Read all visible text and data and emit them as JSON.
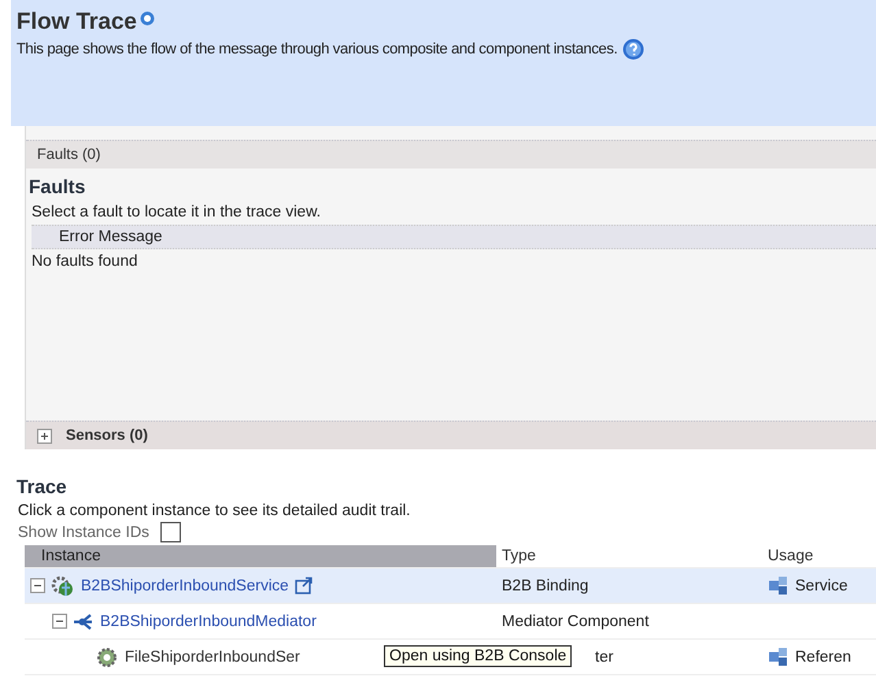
{
  "header": {
    "title": "Flow Trace",
    "description": "This page shows the flow of the message through various composite and component instances."
  },
  "faults_panel": {
    "bar_label": "Faults (0)",
    "heading": "Faults",
    "hint": "Select a fault to locate it in the trace view.",
    "column": "Error Message",
    "empty_text": "No faults found"
  },
  "sensors_panel": {
    "bar_label": "Sensors (0)",
    "expanded": false
  },
  "trace": {
    "heading": "Trace",
    "hint": "Click a component instance to see its detailed audit trail.",
    "show_ids": {
      "label": "Show Instance IDs",
      "checked": false
    },
    "columns": [
      "Instance",
      "Type",
      "Usage"
    ],
    "rows": [
      {
        "name": "B2BShiporderInboundService",
        "type": "B2B Binding",
        "usage": "Service",
        "kind": "service",
        "expanded": true,
        "selected": true,
        "children": [
          {
            "name": "B2BShiporderInboundMediator",
            "type": "Mediator Component",
            "kind": "mediator",
            "expanded": true,
            "selected": false,
            "children": [
              {
                "name": "FileShiporderInboundSer",
                "type": "ter",
                "usage": "Referen",
                "kind": "adapter",
                "selected": false
              }
            ]
          }
        ]
      }
    ]
  },
  "tooltip": "Open using B2B Console"
}
